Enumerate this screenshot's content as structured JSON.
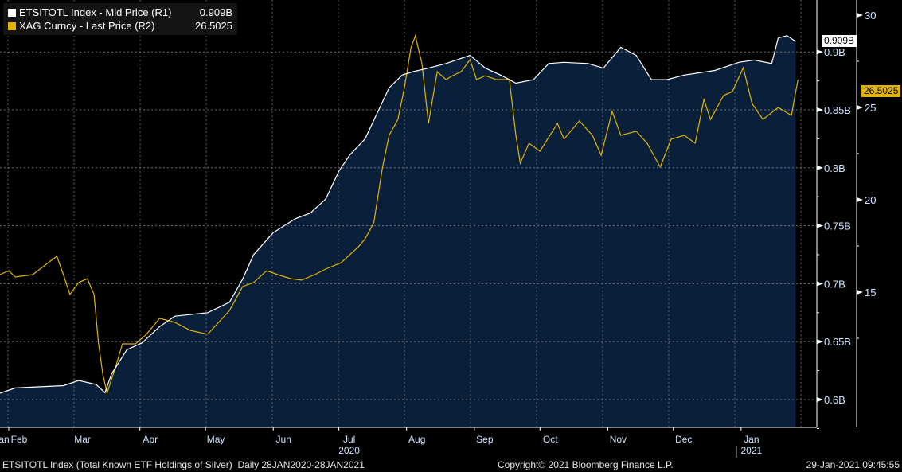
{
  "chart_data": {
    "type": "line",
    "title": "ETSITOTL Index (Total Known ETF Holdings of Silver)",
    "xlabel": "",
    "x_unit": "days since 28JAN2020",
    "x_range": [
      0,
      366
    ],
    "month_ticks": [
      {
        "label": "Jan",
        "day": -4
      },
      {
        "label": "Feb",
        "day": 4
      },
      {
        "label": "Mar",
        "day": 33
      },
      {
        "label": "Apr",
        "day": 64
      },
      {
        "label": "May",
        "day": 94
      },
      {
        "label": "Jun",
        "day": 125
      },
      {
        "label": "Jul",
        "day": 155
      },
      {
        "label": "Aug",
        "day": 186
      },
      {
        "label": "Sep",
        "day": 217
      },
      {
        "label": "Oct",
        "day": 247
      },
      {
        "label": "Nov",
        "day": 278
      },
      {
        "label": "Dec",
        "day": 308
      },
      {
        "label": "Jan",
        "day": 339
      }
    ],
    "year_labels": [
      {
        "label": "2020",
        "day": 155
      },
      {
        "label": "2021",
        "day": 339
      }
    ],
    "axes": {
      "r1": {
        "label": "R1",
        "range": [
          0.575,
          0.925
        ],
        "ticks": [
          0.6,
          0.65,
          0.7,
          0.75,
          0.8,
          0.85,
          0.9
        ],
        "tick_labels": [
          "0.6B",
          "0.65B",
          "0.7B",
          "0.75B",
          "0.8B",
          "0.85B",
          "0.9B"
        ]
      },
      "r2": {
        "label": "R2",
        "range": [
          8.8,
          30.8
        ],
        "ticks": [
          15,
          20,
          25,
          30
        ],
        "tick_labels": [
          "15",
          "20",
          "25",
          "30"
        ]
      }
    },
    "series": [
      {
        "name": "ETSITOTL Index - Mid Price (R1)",
        "last": "0.909B",
        "axis": "r1",
        "color": "#ffffff",
        "fill": "#0a1f3a",
        "x": [
          0,
          7,
          29,
          36,
          44,
          48,
          51,
          58,
          65,
          73,
          80,
          95,
          105,
          111,
          116,
          125,
          135,
          142,
          149,
          155,
          160,
          167,
          173,
          178,
          184,
          189,
          196,
          204,
          215,
          222,
          229,
          236,
          244,
          251,
          258,
          269,
          276,
          284,
          291,
          298,
          305,
          313,
          320,
          327,
          338,
          345,
          353,
          356,
          360,
          364
        ],
        "y": [
          0.6055,
          0.61,
          0.612,
          0.6165,
          0.613,
          0.606,
          0.622,
          0.643,
          0.649,
          0.663,
          0.672,
          0.675,
          0.684,
          0.704,
          0.725,
          0.744,
          0.756,
          0.761,
          0.773,
          0.797,
          0.811,
          0.825,
          0.849,
          0.869,
          0.88,
          0.883,
          0.886,
          0.89,
          0.897,
          0.886,
          0.88,
          0.873,
          0.876,
          0.89,
          0.891,
          0.89,
          0.886,
          0.904,
          0.897,
          0.876,
          0.876,
          0.88,
          0.882,
          0.884,
          0.891,
          0.893,
          0.89,
          0.912,
          0.914,
          0.909
        ]
      },
      {
        "name": "XAG Curncy - Last Price (R2)",
        "last": "26.5025",
        "axis": "r2",
        "color": "#e0b400",
        "x": [
          0,
          4,
          7,
          15,
          22,
          26,
          29,
          32,
          36,
          40,
          43,
          45,
          47,
          49,
          53,
          56,
          62,
          67,
          73,
          80,
          87,
          95,
          100,
          105,
          111,
          116,
          122,
          127,
          133,
          138,
          144,
          149,
          156,
          164,
          167,
          171,
          175,
          178,
          182,
          185,
          188,
          190,
          193,
          196,
          200,
          204,
          207,
          211,
          215,
          218,
          222,
          227,
          233,
          236,
          238,
          242,
          247,
          255,
          258,
          265,
          271,
          275,
          280,
          284,
          291,
          296,
          302,
          307,
          313,
          318,
          322,
          325,
          331,
          335,
          340,
          344,
          349,
          356,
          362,
          365
        ],
        "y": [
          15.95,
          16.16,
          15.82,
          15.95,
          16.59,
          16.94,
          15.95,
          14.87,
          15.52,
          15.73,
          14.87,
          12.28,
          10.56,
          9.53,
          10.99,
          12.2,
          12.2,
          12.72,
          13.58,
          13.36,
          12.93,
          12.72,
          13.36,
          14.01,
          15.3,
          15.52,
          16.16,
          15.95,
          15.73,
          15.65,
          15.95,
          16.25,
          16.59,
          17.46,
          17.89,
          18.75,
          21.77,
          23.49,
          24.35,
          26.08,
          28.23,
          28.88,
          27.37,
          24.14,
          26.94,
          26.51,
          26.72,
          26.94,
          27.59,
          26.51,
          26.72,
          26.51,
          26.51,
          23.49,
          21.98,
          23.06,
          22.63,
          24.14,
          23.28,
          24.27,
          23.49,
          22.41,
          24.78,
          23.49,
          23.71,
          23.06,
          21.77,
          23.28,
          23.49,
          23.06,
          25.43,
          24.35,
          25.65,
          25.86,
          27.15,
          25.21,
          24.35,
          25.0,
          24.57,
          26.5025
        ]
      }
    ]
  },
  "footer": {
    "description": "ETSITOTL Index (Total Known ETF Holdings of Silver)  Daily 28JAN2020-28JAN2021",
    "copyright": "Copyright© 2021 Bloomberg Finance L.P.",
    "timestamp": "29-Jan-2021 09:45:55"
  }
}
